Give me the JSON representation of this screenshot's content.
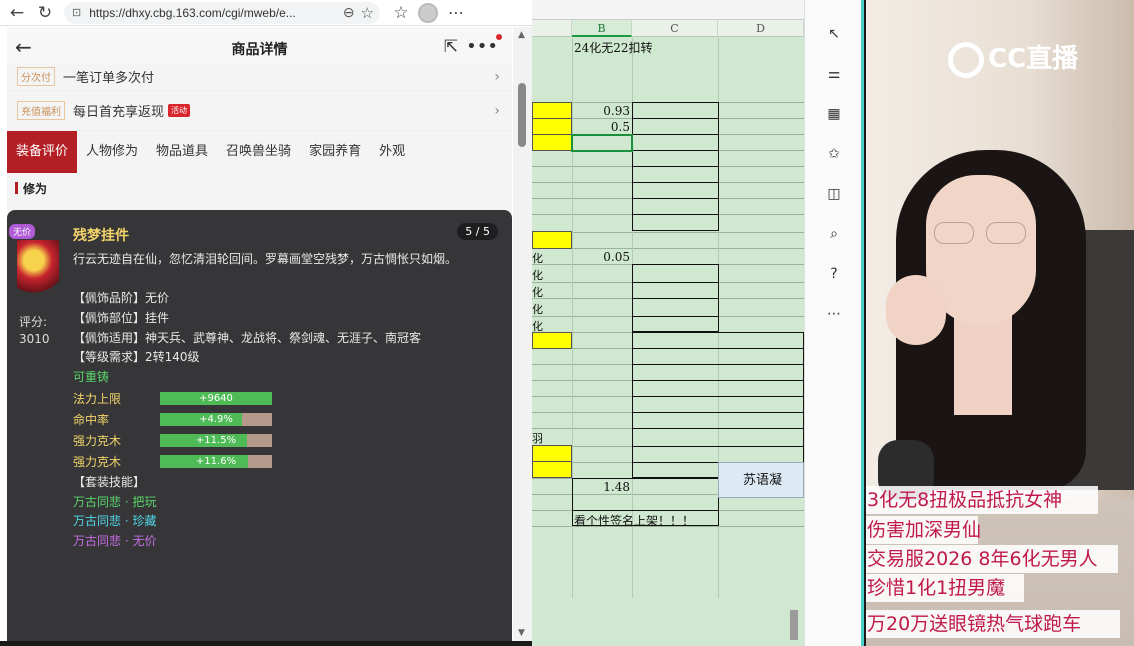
{
  "browser": {
    "url": "https://dhxy.cbg.163.com/cgi/mweb/e..."
  },
  "mobile": {
    "title": "商品详情",
    "rows": [
      {
        "tag": "分次付",
        "text": "一笔订单多次付"
      },
      {
        "tag": "充值福利",
        "text": "每日首充享返现",
        "badge": "活动"
      }
    ],
    "tabs": [
      "装备评价",
      "人物修为",
      "物品道具",
      "召唤兽坐骑",
      "家园养育",
      "外观"
    ],
    "section": "修为",
    "item": {
      "badge": "无价",
      "name": "残梦挂件",
      "page": "5 / 5",
      "score_label": "评分:",
      "score": "3010",
      "desc": "行云无迹自在仙，忽忆清泪轮回间。罗幕画堂空残梦，万古惆怅只如烟。",
      "lines": [
        "【佩饰品阶】无价",
        "【佩饰部位】挂件",
        "【佩饰适用】神天兵、武尊神、龙战将、祭剑魂、无涯子、南冠客",
        "【等级需求】2转140级"
      ],
      "recast": "可重铸",
      "stats": [
        {
          "name": "法力上限",
          "value": "+9640",
          "fill": 1.0
        },
        {
          "name": "命中率",
          "value": "+4.9%",
          "fill": 0.73
        },
        {
          "name": "强力克木",
          "value": "+11.5%",
          "fill": 0.78
        },
        {
          "name": "强力克木",
          "value": "+11.6%",
          "fill": 0.79
        }
      ],
      "skill_title": "【套装技能】",
      "skills": [
        {
          "text": "万古同悲 · 把玩",
          "color": "#59d66b"
        },
        {
          "text": "万古同悲 · 珍藏",
          "color": "#4fd6e6"
        },
        {
          "text": "万古同悲 · 无价",
          "color": "#c66ee6"
        }
      ]
    }
  },
  "sheet": {
    "columns": [
      "B",
      "C",
      "D"
    ],
    "top_text": "24化无22扣转",
    "values": [
      "0.93",
      "0.5",
      "0.05",
      "1.48"
    ],
    "bottom_text": "看个性签名上架！！！",
    "side_box": "苏语凝",
    "frag_marks": [
      "化",
      "化",
      "化",
      "化",
      "化"
    ],
    "frag_yu": "羽"
  },
  "stream": {
    "logo": "CC直播",
    "danmu": [
      "3化无8扭极品抵抗女神",
      "伤害加深男仙",
      "交易服2026 8年6化无男人",
      "珍惜1化1扭男魔",
      "万20万送眼镜热气球跑车"
    ]
  },
  "colors": {
    "accent_red": "#b31f24",
    "sheet_green": "#cfe8cf",
    "sheet_yellow": "#ffff00",
    "danmu_pink": "#c0184e"
  }
}
